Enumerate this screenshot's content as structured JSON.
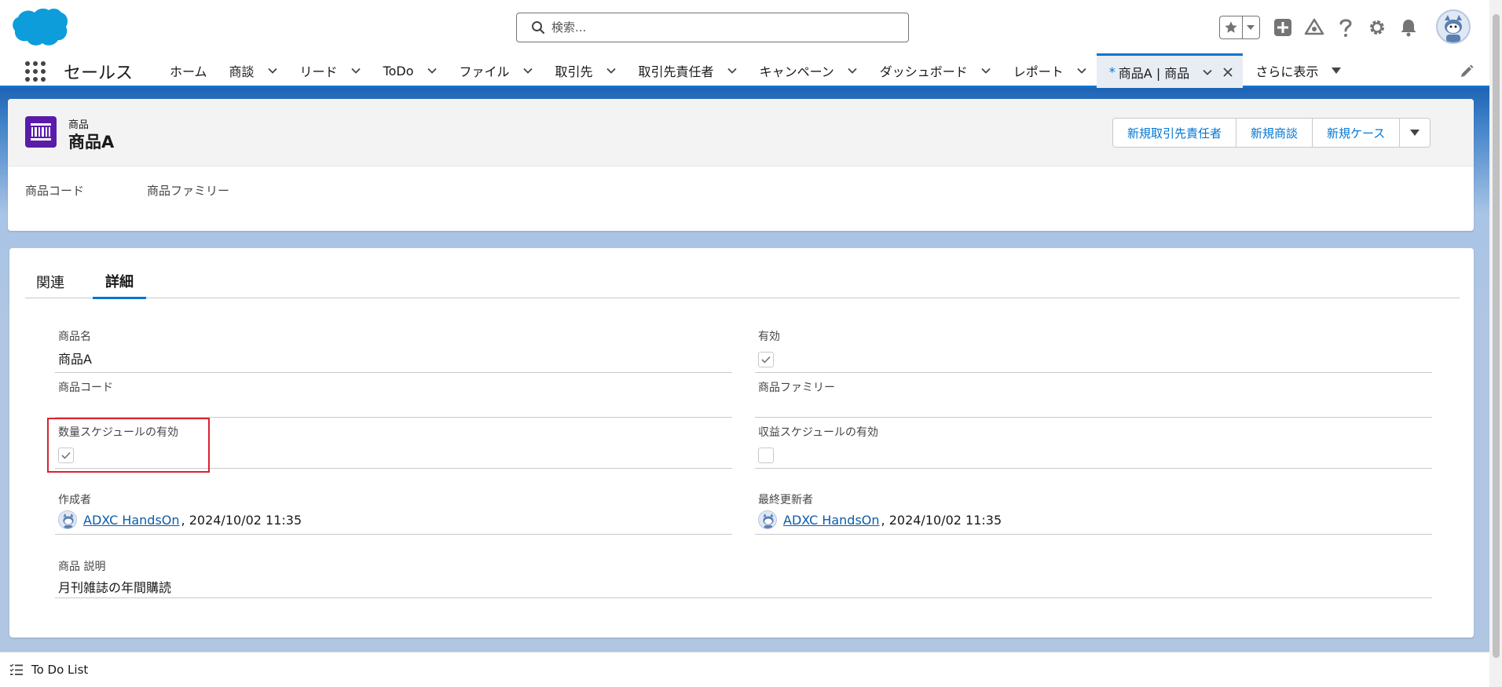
{
  "header": {
    "search_placeholder": "検索..."
  },
  "nav": {
    "app_name": "セールス",
    "items": [
      {
        "label": "ホーム",
        "has_menu": false
      },
      {
        "label": "商談",
        "has_menu": true
      },
      {
        "label": "リード",
        "has_menu": true
      },
      {
        "label": "ToDo",
        "has_menu": true
      },
      {
        "label": "ファイル",
        "has_menu": true
      },
      {
        "label": "取引先",
        "has_menu": true
      },
      {
        "label": "取引先責任者",
        "has_menu": true
      },
      {
        "label": "キャンペーン",
        "has_menu": true
      },
      {
        "label": "ダッシュボード",
        "has_menu": true
      },
      {
        "label": "レポート",
        "has_menu": true
      }
    ],
    "active_tab": {
      "marker": "*",
      "label": "商品A | 商品"
    },
    "more_label": "さらに表示"
  },
  "record": {
    "kind": "商品",
    "title": "商品A",
    "actions": [
      "新規取引先責任者",
      "新規商談",
      "新規ケース"
    ],
    "highlights": [
      "商品コード",
      "商品ファミリー"
    ]
  },
  "tabs": {
    "related": "関連",
    "details": "詳細"
  },
  "fields": {
    "product_name": {
      "label": "商品名",
      "value": "商品A"
    },
    "active": {
      "label": "有効",
      "checked": true
    },
    "product_code": {
      "label": "商品コード",
      "value": ""
    },
    "product_family": {
      "label": "商品ファミリー",
      "value": ""
    },
    "quantity_schedule": {
      "label": "数量スケジュールの有効",
      "checked": true
    },
    "revenue_schedule": {
      "label": "収益スケジュールの有効",
      "checked": false
    },
    "created_by": {
      "label": "作成者",
      "user": "ADXC HandsOn",
      "date": ", 2024/10/02 11:35"
    },
    "modified_by": {
      "label": "最終更新者",
      "user": "ADXC HandsOn",
      "date": ", 2024/10/02 11:35"
    },
    "description": {
      "label": "商品 説明",
      "value": "月刊雑誌の年間購読"
    }
  },
  "utility": {
    "todo_label": "To Do List"
  },
  "colors": {
    "brand_blue": "#0176d3",
    "product_icon": "#5a1ba9",
    "highlight_red": "#d9232e"
  }
}
